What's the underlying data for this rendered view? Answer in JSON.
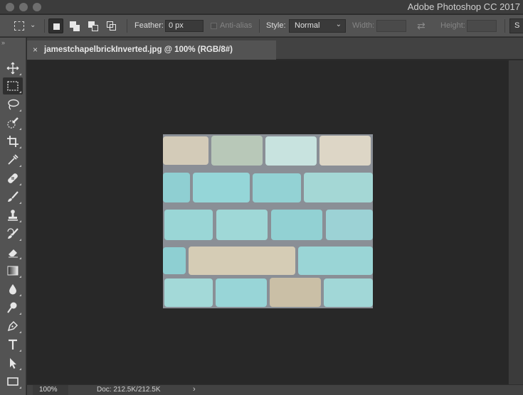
{
  "app": {
    "title": "Adobe Photoshop CC 2017"
  },
  "options_bar": {
    "feather_label": "Feather:",
    "feather_value": "0 px",
    "antialias_label": "Anti-alias",
    "style_label": "Style:",
    "style_value": "Normal",
    "width_label": "Width:",
    "height_label": "Height:",
    "refine_label": "S"
  },
  "document": {
    "tab_title": "jamestchapelbrickInverted.jpg @ 100% (RGB/8#)",
    "close_glyph": "×"
  },
  "status_bar": {
    "zoom": "100%",
    "doc_size": "Doc: 212.5K/212.5K",
    "arrow": "›"
  },
  "toolbar": {
    "grip": "››",
    "tools": [
      {
        "name": "move-tool",
        "icon": "move-icon"
      },
      {
        "name": "rectangular-marquee-tool",
        "icon": "marquee-icon",
        "active": true
      },
      {
        "name": "lasso-tool",
        "icon": "lasso-icon"
      },
      {
        "name": "quick-selection-tool",
        "icon": "quick-selection-icon"
      },
      {
        "name": "crop-tool",
        "icon": "crop-icon"
      },
      {
        "name": "eyedropper-tool",
        "icon": "eyedropper-icon"
      },
      {
        "name": "healing-brush-tool",
        "icon": "bandage-icon"
      },
      {
        "name": "brush-tool",
        "icon": "brush-icon"
      },
      {
        "name": "clone-stamp-tool",
        "icon": "stamp-icon"
      },
      {
        "name": "history-brush-tool",
        "icon": "history-brush-icon"
      },
      {
        "name": "eraser-tool",
        "icon": "eraser-icon"
      },
      {
        "name": "gradient-tool",
        "icon": "gradient-icon"
      },
      {
        "name": "blur-tool",
        "icon": "drop-icon"
      },
      {
        "name": "dodge-tool",
        "icon": "dodge-icon"
      },
      {
        "name": "pen-tool",
        "icon": "pen-icon"
      },
      {
        "name": "type-tool",
        "icon": "type-icon"
      },
      {
        "name": "path-selection-tool",
        "icon": "arrow-cursor-icon"
      },
      {
        "name": "rectangle-tool",
        "icon": "rectangle-icon"
      }
    ]
  },
  "colors": {
    "ui_panel": "#535353",
    "canvas_bg": "#282828",
    "brick_teal": "#8fd3d6",
    "brick_beige": "#d8cdb8",
    "mortar": "#8a8f96"
  }
}
